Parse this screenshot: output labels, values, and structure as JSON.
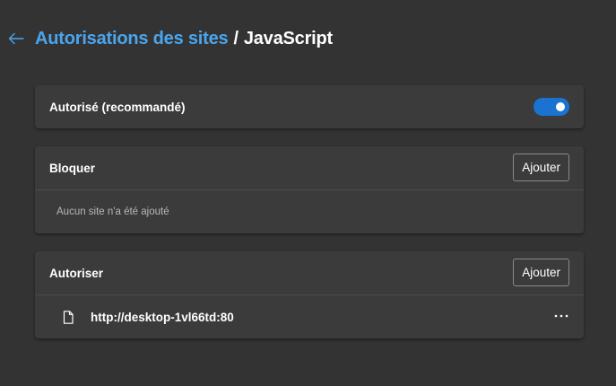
{
  "header": {
    "back_icon": "arrow-left-icon",
    "breadcrumb_parent": "Autorisations des sites",
    "breadcrumb_separator": "/",
    "breadcrumb_current": "JavaScript"
  },
  "allowed_setting": {
    "label": "Autorisé (recommandé)",
    "toggle_on": true
  },
  "block_section": {
    "title": "Bloquer",
    "add_label": "Ajouter",
    "empty_text": "Aucun site n'a été ajouté"
  },
  "allow_section": {
    "title": "Autoriser",
    "add_label": "Ajouter",
    "sites": [
      {
        "url": "http://desktop-1vl66td:80",
        "icon": "file-icon",
        "menu_icon": "more-actions-icon"
      }
    ]
  },
  "colors": {
    "background": "#333333",
    "card": "#3b3b3b",
    "link": "#4aa6ee",
    "toggle_on": "#1a73d0"
  }
}
